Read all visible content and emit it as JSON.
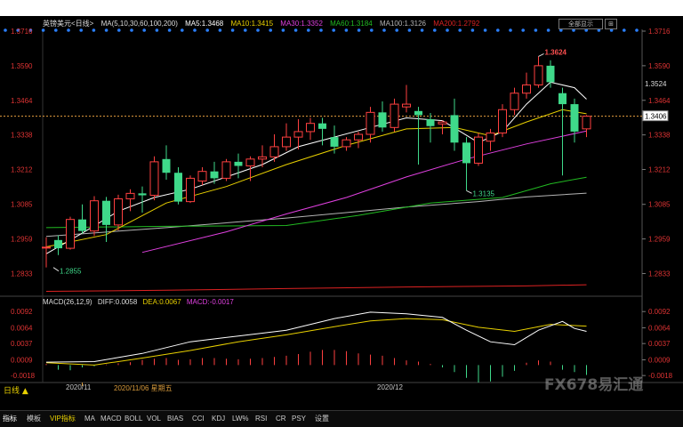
{
  "header": {
    "symbol": "英镑美元<日线>",
    "ma_params": "MA(5,10,30,60,100,200)",
    "ma5": "MA5:1.3468",
    "ma10": "MA10:1.3415",
    "ma30": "MA30:1.3352",
    "ma60": "MA60:1.3184",
    "ma100": "MA100:1.3126",
    "ma200": "MA200:1.2792"
  },
  "top_buttons": [
    "全部显示",
    "⊞"
  ],
  "price_axis": {
    "ticks": [
      "1.3716",
      "1.3590",
      "1.3464",
      "1.3338",
      "1.3212",
      "1.3085",
      "1.2959",
      "1.2833"
    ],
    "last_price": "1.3406",
    "ma5_tag": "1.3524"
  },
  "annotations": {
    "high": "1.3624",
    "mid_low": "1.3135",
    "low": "1.2855"
  },
  "macd": {
    "title": "MACD(26,12,9)",
    "diff": "DIFF:0.0058",
    "dea": "DEA:0.0067",
    "macd": "MACD:-0.0017",
    "ticks": [
      "0.0092",
      "0.0064",
      "0.0037",
      "0.0009",
      "-0.0018"
    ]
  },
  "x_axis": {
    "period": "日线 ▲",
    "labels": [
      "2020/11",
      "2020/11/06 星期五",
      "2020/12"
    ]
  },
  "tabs": [
    "指标",
    "模板",
    "VIP指标",
    "MA",
    "MACD",
    "BOLL",
    "VOL",
    "BIAS",
    "CCI",
    "KDJ",
    "LW%",
    "RSI",
    "CR",
    "PSY",
    "设置"
  ],
  "watermark": "FX678易汇通",
  "colors": {
    "background": "#000000",
    "up_candle": "#ff4040",
    "down_candle": "#3fd98a",
    "ma5": "#ffffff",
    "ma10": "#e8d000",
    "ma30": "#e040e0",
    "ma60": "#22bb22",
    "ma100": "#b4b4b4",
    "ma200": "#dd2222",
    "price_axis_text": "#dd3333",
    "macd_title": "#dddddd",
    "dea": "#e8d000",
    "macd_value": "#e040e0"
  },
  "chart_data": {
    "type": "candlestick",
    "price_range": [
      1.276,
      1.3716
    ],
    "candles": [
      {
        "o": 1.2929,
        "h": 1.2965,
        "l": 1.2855,
        "c": 1.2929
      },
      {
        "o": 1.2955,
        "h": 1.2972,
        "l": 1.29,
        "c": 1.2925
      },
      {
        "o": 1.2925,
        "h": 1.304,
        "l": 1.292,
        "c": 1.303
      },
      {
        "o": 1.303,
        "h": 1.3085,
        "l": 1.2978,
        "c": 1.2988
      },
      {
        "o": 1.2988,
        "h": 1.3115,
        "l": 1.297,
        "c": 1.3098
      },
      {
        "o": 1.3098,
        "h": 1.3112,
        "l": 1.2948,
        "c": 1.301
      },
      {
        "o": 1.301,
        "h": 1.312,
        "l": 1.299,
        "c": 1.3105
      },
      {
        "o": 1.3105,
        "h": 1.314,
        "l": 1.306,
        "c": 1.3125
      },
      {
        "o": 1.3125,
        "h": 1.315,
        "l": 1.3055,
        "c": 1.3118
      },
      {
        "o": 1.3118,
        "h": 1.326,
        "l": 1.31,
        "c": 1.324
      },
      {
        "o": 1.325,
        "h": 1.33,
        "l": 1.3175,
        "c": 1.32
      },
      {
        "o": 1.32,
        "h": 1.322,
        "l": 1.3085,
        "c": 1.3095
      },
      {
        "o": 1.3095,
        "h": 1.319,
        "l": 1.309,
        "c": 1.318
      },
      {
        "o": 1.317,
        "h": 1.322,
        "l": 1.3155,
        "c": 1.3205
      },
      {
        "o": 1.3205,
        "h": 1.324,
        "l": 1.316,
        "c": 1.318
      },
      {
        "o": 1.318,
        "h": 1.325,
        "l": 1.317,
        "c": 1.324
      },
      {
        "o": 1.324,
        "h": 1.327,
        "l": 1.318,
        "c": 1.3225
      },
      {
        "o": 1.3225,
        "h": 1.326,
        "l": 1.317,
        "c": 1.325
      },
      {
        "o": 1.325,
        "h": 1.33,
        "l": 1.322,
        "c": 1.3258
      },
      {
        "o": 1.3258,
        "h": 1.334,
        "l": 1.324,
        "c": 1.3295
      },
      {
        "o": 1.3295,
        "h": 1.338,
        "l": 1.328,
        "c": 1.333
      },
      {
        "o": 1.333,
        "h": 1.3395,
        "l": 1.3285,
        "c": 1.335
      },
      {
        "o": 1.335,
        "h": 1.34,
        "l": 1.332,
        "c": 1.338
      },
      {
        "o": 1.338,
        "h": 1.34,
        "l": 1.33,
        "c": 1.336
      },
      {
        "o": 1.333,
        "h": 1.3372,
        "l": 1.327,
        "c": 1.3295
      },
      {
        "o": 1.3295,
        "h": 1.333,
        "l": 1.328,
        "c": 1.332
      },
      {
        "o": 1.332,
        "h": 1.335,
        "l": 1.329,
        "c": 1.334
      },
      {
        "o": 1.334,
        "h": 1.344,
        "l": 1.331,
        "c": 1.342
      },
      {
        "o": 1.342,
        "h": 1.346,
        "l": 1.335,
        "c": 1.3365
      },
      {
        "o": 1.3365,
        "h": 1.347,
        "l": 1.335,
        "c": 1.345
      },
      {
        "o": 1.344,
        "h": 1.352,
        "l": 1.342,
        "c": 1.345
      },
      {
        "o": 1.3425,
        "h": 1.344,
        "l": 1.323,
        "c": 1.341
      },
      {
        "o": 1.3395,
        "h": 1.3418,
        "l": 1.331,
        "c": 1.337
      },
      {
        "o": 1.3378,
        "h": 1.339,
        "l": 1.334,
        "c": 1.3385
      },
      {
        "o": 1.341,
        "h": 1.347,
        "l": 1.328,
        "c": 1.331
      },
      {
        "o": 1.331,
        "h": 1.333,
        "l": 1.3135,
        "c": 1.3235
      },
      {
        "o": 1.3235,
        "h": 1.3345,
        "l": 1.3225,
        "c": 1.333
      },
      {
        "o": 1.3315,
        "h": 1.336,
        "l": 1.328,
        "c": 1.3345
      },
      {
        "o": 1.3345,
        "h": 1.345,
        "l": 1.333,
        "c": 1.343
      },
      {
        "o": 1.343,
        "h": 1.351,
        "l": 1.341,
        "c": 1.349
      },
      {
        "o": 1.349,
        "h": 1.3565,
        "l": 1.347,
        "c": 1.352
      },
      {
        "o": 1.352,
        "h": 1.3624,
        "l": 1.351,
        "c": 1.359
      },
      {
        "o": 1.359,
        "h": 1.361,
        "l": 1.351,
        "c": 1.353
      },
      {
        "o": 1.349,
        "h": 1.351,
        "l": 1.319,
        "c": 1.345
      },
      {
        "o": 1.345,
        "h": 1.347,
        "l": 1.331,
        "c": 1.335
      },
      {
        "o": 1.336,
        "h": 1.341,
        "l": 1.333,
        "c": 1.3406
      }
    ],
    "ma_lines": {
      "ma5": [
        [
          0,
          1.2905
        ],
        [
          3,
          1.298
        ],
        [
          6,
          1.306
        ],
        [
          9,
          1.311
        ],
        [
          12,
          1.314
        ],
        [
          15,
          1.3185
        ],
        [
          18,
          1.323
        ],
        [
          21,
          1.3295
        ],
        [
          24,
          1.333
        ],
        [
          27,
          1.3365
        ],
        [
          30,
          1.34
        ],
        [
          33,
          1.339
        ],
        [
          36,
          1.331
        ],
        [
          38,
          1.335
        ],
        [
          40,
          1.345
        ],
        [
          42,
          1.353
        ],
        [
          44,
          1.351
        ],
        [
          45,
          1.3468
        ]
      ],
      "ma10": [
        [
          0,
          1.293
        ],
        [
          5,
          1.2975
        ],
        [
          10,
          1.309
        ],
        [
          15,
          1.315
        ],
        [
          20,
          1.323
        ],
        [
          25,
          1.33
        ],
        [
          30,
          1.336
        ],
        [
          34,
          1.3365
        ],
        [
          37,
          1.3335
        ],
        [
          40,
          1.3385
        ],
        [
          43,
          1.343
        ],
        [
          45,
          1.3415
        ]
      ],
      "ma30": [
        [
          8,
          1.291
        ],
        [
          15,
          1.2985
        ],
        [
          20,
          1.305
        ],
        [
          25,
          1.311
        ],
        [
          30,
          1.3185
        ],
        [
          35,
          1.325
        ],
        [
          40,
          1.3305
        ],
        [
          45,
          1.3352
        ]
      ],
      "ma60": [
        [
          0,
          1.3
        ],
        [
          10,
          1.3005
        ],
        [
          20,
          1.3008
        ],
        [
          26,
          1.3045
        ],
        [
          32,
          1.309
        ],
        [
          38,
          1.311
        ],
        [
          42,
          1.316
        ],
        [
          45,
          1.3184
        ]
      ],
      "ma100": [
        [
          0,
          1.2968
        ],
        [
          10,
          1.3
        ],
        [
          20,
          1.3035
        ],
        [
          30,
          1.3075
        ],
        [
          36,
          1.3095
        ],
        [
          40,
          1.3112
        ],
        [
          45,
          1.3126
        ]
      ],
      "ma200": [
        [
          0,
          1.2768
        ],
        [
          10,
          1.2772
        ],
        [
          20,
          1.2778
        ],
        [
          30,
          1.2784
        ],
        [
          40,
          1.2788
        ],
        [
          45,
          1.2792
        ]
      ]
    },
    "macd_range": [
      -0.003,
      0.01
    ],
    "diff": [
      [
        0,
        0.0005
      ],
      [
        4,
        0.0006
      ],
      [
        8,
        0.002
      ],
      [
        12,
        0.004
      ],
      [
        16,
        0.005
      ],
      [
        20,
        0.006
      ],
      [
        24,
        0.008
      ],
      [
        27,
        0.0091
      ],
      [
        30,
        0.0088
      ],
      [
        33,
        0.0082
      ],
      [
        35,
        0.006
      ],
      [
        37,
        0.004
      ],
      [
        39,
        0.0035
      ],
      [
        41,
        0.006
      ],
      [
        43,
        0.0075
      ],
      [
        44,
        0.0063
      ],
      [
        45,
        0.0058
      ]
    ],
    "dea": [
      [
        0,
        0.0004
      ],
      [
        4,
        0.0
      ],
      [
        8,
        0.0012
      ],
      [
        12,
        0.0025
      ],
      [
        16,
        0.004
      ],
      [
        20,
        0.0052
      ],
      [
        24,
        0.0066
      ],
      [
        27,
        0.0076
      ],
      [
        30,
        0.008
      ],
      [
        33,
        0.0078
      ],
      [
        36,
        0.0065
      ],
      [
        39,
        0.0058
      ],
      [
        42,
        0.007
      ],
      [
        45,
        0.0067
      ]
    ],
    "macd_bars": [
      0.0002,
      -0.0008,
      -0.0009,
      -0.0004,
      -0.0002,
      0.0001,
      0.0003,
      0.0005,
      0.0009,
      0.0011,
      0.0012,
      0.0009,
      0.001,
      0.0012,
      0.0012,
      0.0011,
      0.001,
      0.0011,
      0.0012,
      0.0014,
      0.0016,
      0.0019,
      0.0023,
      0.0026,
      0.0026,
      0.0024,
      0.002,
      0.0018,
      0.0016,
      0.0012,
      0.0008,
      0.0006,
      0.0002,
      -0.0004,
      -0.0012,
      -0.0022,
      -0.003,
      -0.0028,
      -0.002,
      -0.001,
      0.0004,
      0.0008,
      0.0006,
      -0.0008,
      -0.0012,
      -0.0017
    ]
  }
}
